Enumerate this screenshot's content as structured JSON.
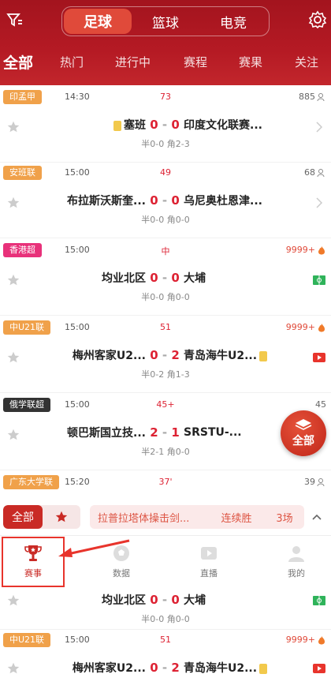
{
  "header": {
    "sports": [
      "足球",
      "篮球",
      "电竞"
    ],
    "active_sport": 0,
    "tabs": [
      "全部",
      "热门",
      "进行中",
      "赛程",
      "赛果",
      "关注"
    ],
    "active_tab": 0
  },
  "matches": [
    {
      "league": "印孟甲",
      "league_color": "#f0a14a",
      "time": "14:30",
      "minute": "73",
      "count": "885",
      "count_icon": "user",
      "home": "",
      "away": "印度文化联赛...",
      "home_score": "0",
      "away_score": "0",
      "home_card": true,
      "away_card": false,
      "sub": "半0-0 角2-3",
      "home_prefix": "塞班",
      "right_icon": "chevron"
    },
    {
      "league": "安班联",
      "league_color": "#f0a14a",
      "time": "15:00",
      "minute": "49",
      "count": "68",
      "count_icon": "user",
      "home": "布拉斯沃斯奎...",
      "away": "乌尼奥杜恩津...",
      "home_score": "0",
      "away_score": "0",
      "home_card": false,
      "away_card": false,
      "sub": "半0-0 角0-0",
      "right_icon": "chevron"
    },
    {
      "league": "香港超",
      "league_color": "#e8317a",
      "time": "15:00",
      "minute": "中",
      "count": "9999+",
      "count_icon": "fire",
      "home": "均业北区",
      "away": "大埔",
      "home_score": "0",
      "away_score": "0",
      "home_card": false,
      "away_card": false,
      "sub": "半0-0 角0-0",
      "right_icon": "field"
    },
    {
      "league": "中U21联",
      "league_color": "#f0a14a",
      "time": "15:00",
      "minute": "51",
      "count": "9999+",
      "count_icon": "fire",
      "home": "梅州客家U2...",
      "away": "青岛海牛U2...",
      "home_score": "0",
      "away_score": "2",
      "home_card": false,
      "away_card": true,
      "sub": "半0-2 角1-3",
      "right_icon": "play"
    },
    {
      "league": "俄学联超",
      "league_color": "#333333",
      "time": "15:00",
      "minute": "45+",
      "count": "45",
      "count_icon": "user",
      "home": "顿巴斯国立技...",
      "away": "SRSTU-...",
      "home_score": "2",
      "away_score": "1",
      "home_card": false,
      "away_card": false,
      "sub": "半2-1 角0-0",
      "right_icon": "none"
    },
    {
      "league": "广东大学联",
      "league_color": "#f0a14a",
      "time": "15:20",
      "minute": "37'",
      "count": "39",
      "count_icon": "user"
    }
  ],
  "float_button": "全部",
  "filter": {
    "all_label": "全部",
    "streak_name": "拉普拉塔体操击剑...",
    "streak_type": "连续胜",
    "streak_count": "3场"
  },
  "bottom_nav": [
    "赛事",
    "数据",
    "直播",
    "我的"
  ],
  "lower_matches": [
    {
      "home": "均业北区",
      "away": "大埔",
      "home_score": "0",
      "away_score": "0",
      "sub": "半0-0 角0-0"
    },
    {
      "league": "中U21联",
      "time": "15:00",
      "minute": "51",
      "count": "9999+",
      "home": "梅州客家U2...",
      "away": "青岛海牛U2...",
      "home_score": "0",
      "away_score": "2"
    }
  ],
  "colors": {
    "brand": "#c92a25",
    "accent": "#e04a3a",
    "score": "#dd2233"
  }
}
